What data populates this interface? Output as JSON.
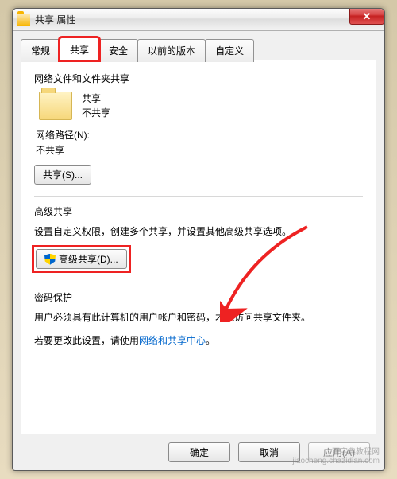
{
  "window": {
    "title": "共享 属性"
  },
  "tabs": {
    "general": "常规",
    "sharing": "共享",
    "security": "安全",
    "previous": "以前的版本",
    "custom": "自定义"
  },
  "section1": {
    "title": "网络文件和文件夹共享",
    "folder_name": "共享",
    "folder_status": "不共享",
    "netpath_label": "网络路径(N):",
    "netpath_value": "不共享",
    "share_btn": "共享(S)..."
  },
  "section2": {
    "title": "高级共享",
    "desc": "设置自定义权限，创建多个共享，并设置其他高级共享选项。",
    "adv_btn": "高级共享(D)..."
  },
  "section3": {
    "title": "密码保护",
    "desc1": "用户必须具有此计算机的用户帐户和密码，才能访问共享文件夹。",
    "desc2_prefix": "若要更改此设置，请使用",
    "desc2_link": "网络和共享中心",
    "desc2_suffix": "。"
  },
  "footer": {
    "ok": "确定",
    "cancel": "取消",
    "apply": "应用(A)"
  },
  "watermark": {
    "l1": "百字典教程网",
    "l2": "jiaocheng.chazidian.com"
  }
}
